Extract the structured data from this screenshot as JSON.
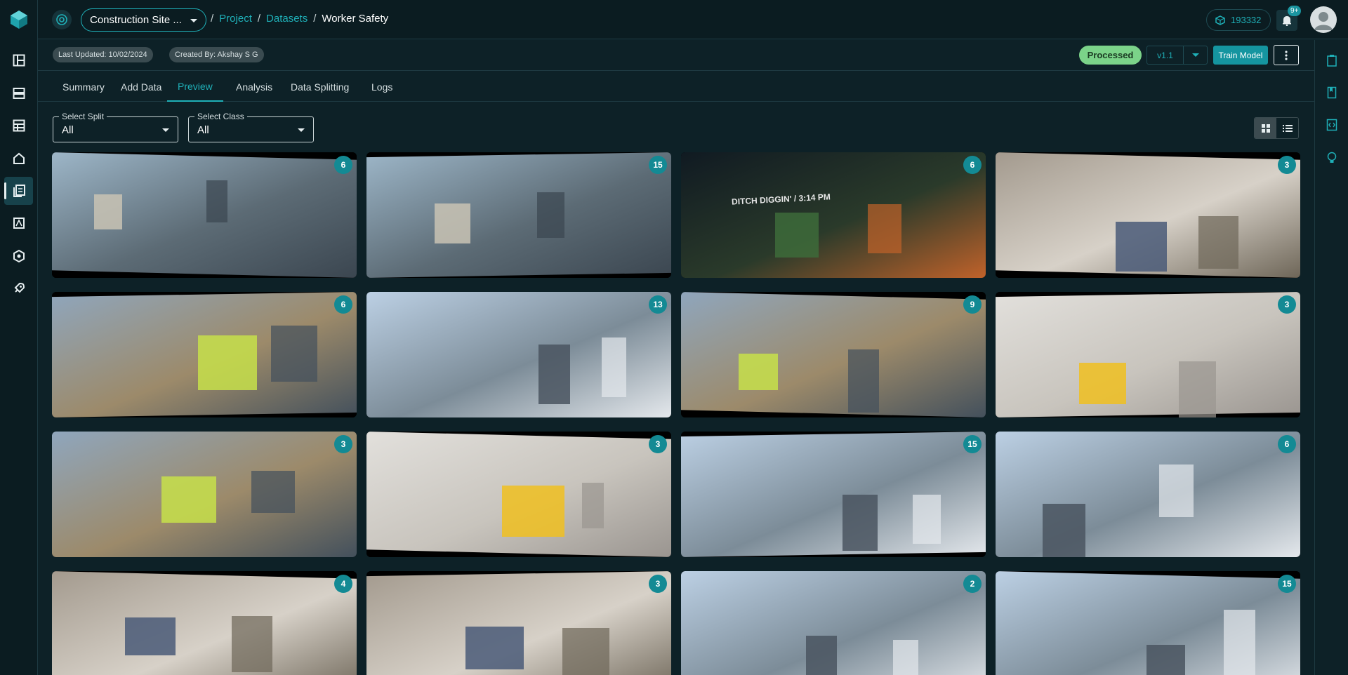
{
  "sidebar": {
    "items": [
      {
        "name": "layout-icon",
        "active": false
      },
      {
        "name": "database-icon",
        "active": false
      },
      {
        "name": "table-icon",
        "active": false
      },
      {
        "name": "home-icon",
        "active": false
      },
      {
        "name": "datasets-icon",
        "active": true
      },
      {
        "name": "annotate-icon",
        "active": false
      },
      {
        "name": "model-icon",
        "active": false
      },
      {
        "name": "deploy-icon",
        "active": false
      }
    ]
  },
  "header": {
    "project_select": "Construction Site ...",
    "breadcrumb": {
      "project": "Project",
      "datasets": "Datasets",
      "current": "Worker Safety",
      "sep": "/"
    },
    "credits": "193332",
    "notifications_badge": "9+"
  },
  "infobar": {
    "last_updated": "Last Updated: 10/02/2024",
    "created_by": "Created By: Akshay S G",
    "status": "Processed",
    "version": "v1.1",
    "train_button": "Train Model"
  },
  "tabs": [
    {
      "label": "Summary",
      "active": false
    },
    {
      "label": "Add Data",
      "active": false
    },
    {
      "label": "Preview",
      "active": true
    },
    {
      "label": "Analysis",
      "active": false
    },
    {
      "label": "Data Splitting",
      "active": false
    },
    {
      "label": "Logs",
      "active": false
    }
  ],
  "filters": {
    "split": {
      "label": "Select Split",
      "value": "All"
    },
    "class": {
      "label": "Select Class",
      "value": "All"
    }
  },
  "images": [
    {
      "count": "6",
      "scene": "scaffold"
    },
    {
      "count": "15",
      "scene": "scaffold"
    },
    {
      "count": "6",
      "scene": "night",
      "caption": "DITCH DIGGIN' / 3:14 PM"
    },
    {
      "count": "3",
      "scene": "indoor"
    },
    {
      "count": "6",
      "scene": "workers"
    },
    {
      "count": "13",
      "scene": "sky"
    },
    {
      "count": "9",
      "scene": "workers"
    },
    {
      "count": "3",
      "scene": "white"
    },
    {
      "count": "3",
      "scene": "workers"
    },
    {
      "count": "3",
      "scene": "white"
    },
    {
      "count": "15",
      "scene": "sky"
    },
    {
      "count": "6",
      "scene": "sky"
    },
    {
      "count": "4",
      "scene": "indoor"
    },
    {
      "count": "3",
      "scene": "indoor"
    },
    {
      "count": "2",
      "scene": "sky"
    },
    {
      "count": "15",
      "scene": "sky"
    }
  ],
  "colors": {
    "accent": "#1fb0b8",
    "badge": "#138a94",
    "processed": "#7bd389",
    "background": "#0d2127"
  }
}
